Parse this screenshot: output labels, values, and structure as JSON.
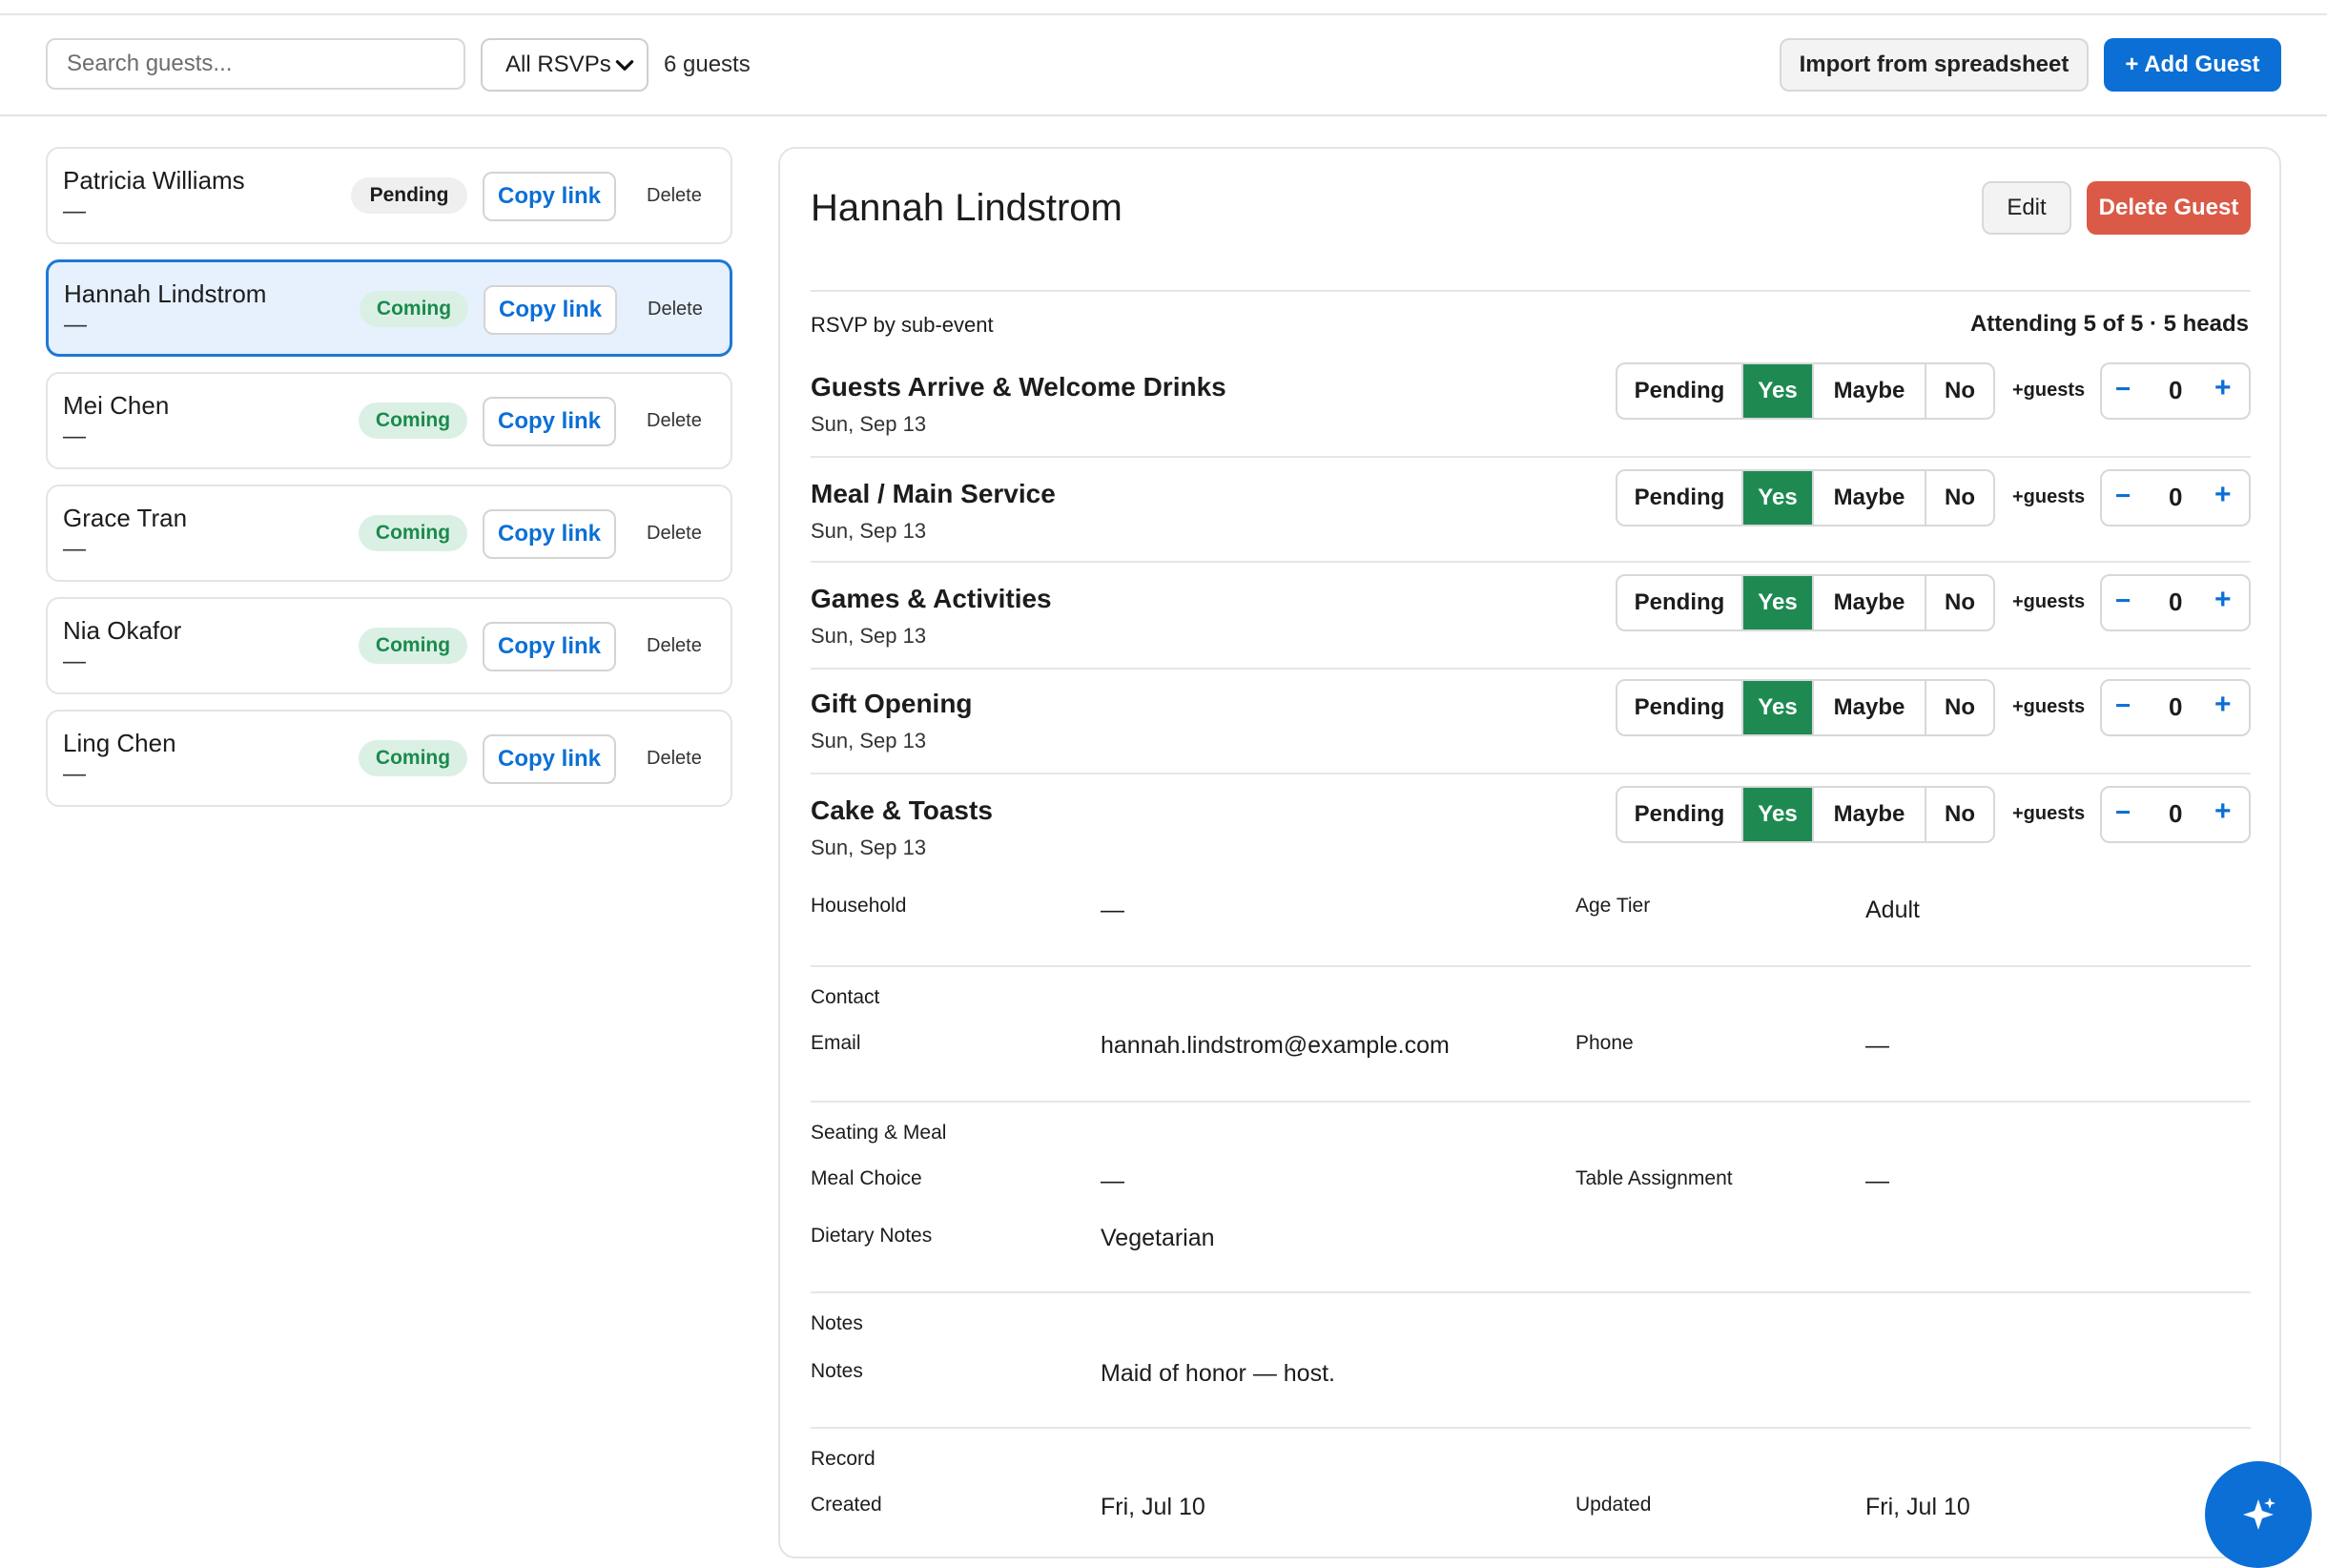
{
  "toolbar": {
    "search_placeholder": "Search guests...",
    "rsvp_filter": "All RSVPs",
    "guest_count": "6 guests",
    "import_label": "Import from spreadsheet",
    "add_label": "+ Add Guest"
  },
  "guests": [
    {
      "name": "Patricia Williams",
      "sub": "—",
      "status": "Pending",
      "copy": "Copy link",
      "delete": "Delete"
    },
    {
      "name": "Hannah Lindstrom",
      "sub": "—",
      "status": "Coming",
      "copy": "Copy link",
      "delete": "Delete"
    },
    {
      "name": "Mei Chen",
      "sub": "—",
      "status": "Coming",
      "copy": "Copy link",
      "delete": "Delete"
    },
    {
      "name": "Grace Tran",
      "sub": "—",
      "status": "Coming",
      "copy": "Copy link",
      "delete": "Delete"
    },
    {
      "name": "Nia Okafor",
      "sub": "—",
      "status": "Coming",
      "copy": "Copy link",
      "delete": "Delete"
    },
    {
      "name": "Ling Chen",
      "sub": "—",
      "status": "Coming",
      "copy": "Copy link",
      "delete": "Delete"
    }
  ],
  "detail": {
    "name": "Hannah Lindstrom",
    "edit_label": "Edit",
    "delete_label": "Delete Guest",
    "rsvp_heading": "RSVP by sub-event",
    "attending": "Attending 5 of 5 · 5 heads",
    "rsvp_options": [
      "Pending",
      "Yes",
      "Maybe",
      "No"
    ],
    "plus_guests_label": "+guests",
    "minus_symbol": "−",
    "plus_symbol": "+",
    "events": [
      {
        "name": "Guests Arrive & Welcome Drinks",
        "date": "Sun, Sep 13",
        "selected": "Yes",
        "extra": "0"
      },
      {
        "name": "Meal / Main Service",
        "date": "Sun, Sep 13",
        "selected": "Yes",
        "extra": "0"
      },
      {
        "name": "Games & Activities",
        "date": "Sun, Sep 13",
        "selected": "Yes",
        "extra": "0"
      },
      {
        "name": "Gift Opening",
        "date": "Sun, Sep 13",
        "selected": "Yes",
        "extra": "0"
      },
      {
        "name": "Cake & Toasts",
        "date": "Sun, Sep 13",
        "selected": "Yes",
        "extra": "0"
      }
    ],
    "household": {
      "label": "Household",
      "value": "—"
    },
    "age_tier": {
      "label": "Age Tier",
      "value": "Adult"
    },
    "contact": {
      "title": "Contact",
      "email_label": "Email",
      "email": "hannah.lindstrom@example.com",
      "phone_label": "Phone",
      "phone": "—"
    },
    "seating": {
      "title": "Seating & Meal",
      "meal_label": "Meal Choice",
      "meal": "—",
      "table_label": "Table Assignment",
      "table": "—",
      "dietary_label": "Dietary Notes",
      "dietary": "Vegetarian"
    },
    "notes": {
      "title": "Notes",
      "notes_label": "Notes",
      "notes": "Maid of honor — host."
    },
    "record": {
      "title": "Record",
      "created_label": "Created",
      "created": "Fri, Jul 10",
      "updated_label": "Updated",
      "updated": "Fri, Jul 10"
    }
  },
  "colors": {
    "accent": "#0b6fd6",
    "yes_green": "#1e8a52",
    "delete_red": "#db5a47",
    "coming_badge_bg": "#dbf0e4",
    "selected_card_bg": "#e6f1fd"
  },
  "icons": {
    "filter_chevron": "chevron-down-icon",
    "fab": "sparkle-icon"
  }
}
